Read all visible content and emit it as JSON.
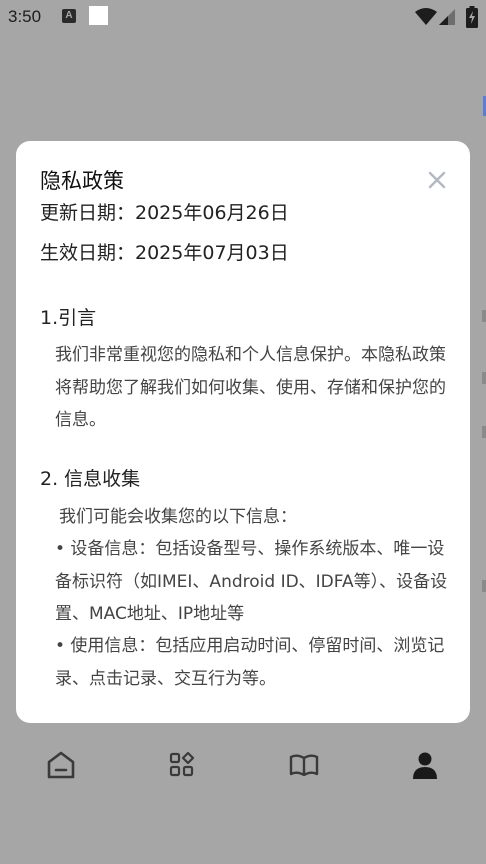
{
  "status_bar": {
    "time": "3:50",
    "indicator_letter": "A",
    "icons": [
      "a-notification-icon",
      "white-square-icon",
      "wifi-icon",
      "signal-icon",
      "battery-charging-icon"
    ]
  },
  "modal": {
    "title": "隐私政策",
    "updated_date": "更新日期：2025年06月26日",
    "effective_date": "生效日期：2025年07月03日",
    "close_icon": "close-icon",
    "sections": [
      {
        "heading": "1.引言",
        "paragraphs": [
          "我们非常重视您的隐私和个人信息保护。本隐私政策将帮助您了解我们如何收集、使用、存储和保护您的信息。"
        ]
      },
      {
        "heading": "2. 信息收集",
        "paragraphs": [
          "我们可能会收集您的以下信息：",
          "• 设备信息：包括设备型号、操作系统版本、唯一设备标识符（如IMEI、Android ID、IDFA等）、设备设置、MAC地址、IP地址等",
          "• 使用信息：包括应用启动时间、停留时间、浏览记录、点击记录、交互行为等。"
        ]
      }
    ]
  },
  "tabbar": {
    "tabs": [
      {
        "icon": "home-icon",
        "active": false
      },
      {
        "icon": "apps-icon",
        "active": false
      },
      {
        "icon": "book-icon",
        "active": false
      },
      {
        "icon": "profile-icon",
        "active": true
      }
    ],
    "active_color": "#1a1a1a",
    "inactive_color": "#3a3a3a"
  },
  "colors": {
    "overlay": "#a6a6a6",
    "modal_bg": "#ffffff",
    "close_icon": "#b3b8c2"
  }
}
